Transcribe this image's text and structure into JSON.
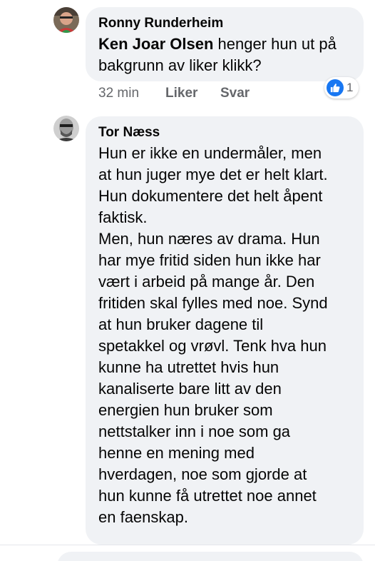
{
  "comments": [
    {
      "author": "Ronny Runderheim",
      "mention": "Ken Joar Olsen",
      "text": " henger hun ut på bakgrunn av liker klikk?",
      "time": "32 min",
      "like_label": "Liker",
      "reply_label": "Svar",
      "reaction_icon": "thumbs-up-icon",
      "reaction_count": "1"
    },
    {
      "author": "Tor Næss",
      "lines": [
        "Hun er ikke en undermåler, men",
        "at hun juger mye det er helt klart.",
        "Hun dokumentere det helt åpent",
        "faktisk.",
        "Men, hun næres av drama. Hun",
        "har mye fritid siden hun ikke har",
        "vært i arbeid på mange år. Den",
        "fritiden skal fylles med noe. Synd",
        "at hun bruker dagene til",
        "spetakkel og vrøvl. Tenk hva hun",
        "kunne ha utrettet hvis hun",
        "kanaliserte bare litt av den",
        "energien hun bruker som",
        "nettstalker inn i noe som ga",
        "henne en mening med",
        "hverdagen, noe som gjorde at",
        "hun kunne få utrettet noe annet",
        "en faenskap."
      ]
    }
  ],
  "colors": {
    "bubble": "#f0f2f5",
    "meta_text": "#65676b",
    "like_blue": "#1877f2"
  }
}
